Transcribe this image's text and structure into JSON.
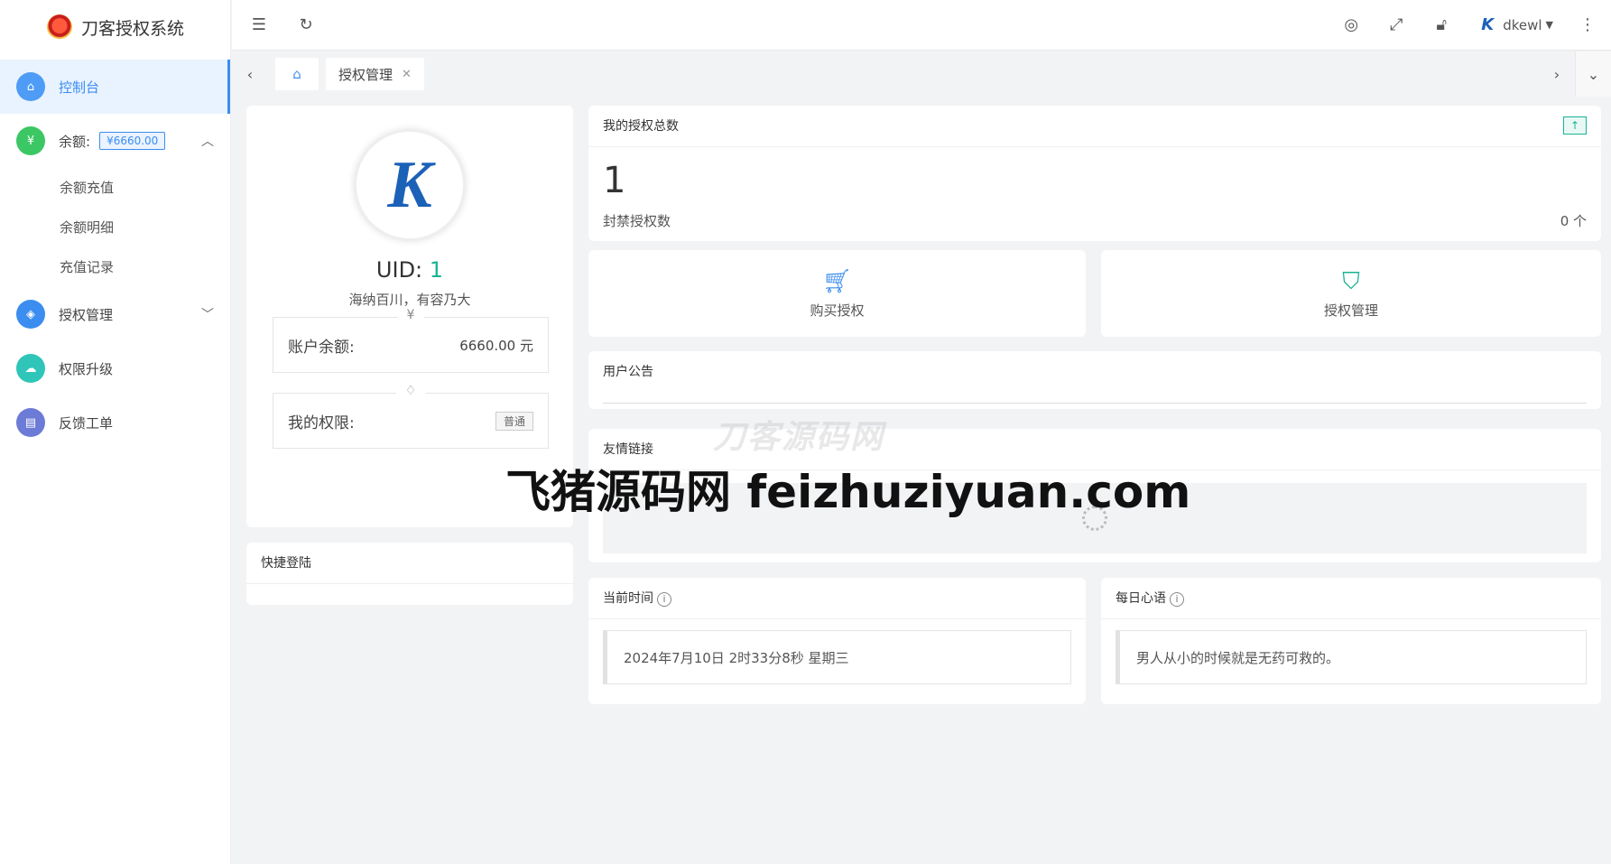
{
  "app": {
    "title": "刀客授权系统"
  },
  "sidebar": {
    "items": [
      {
        "label": "控制台",
        "icon": "home-icon",
        "color": "#4e9cf5"
      },
      {
        "label": "余额:",
        "icon": "yen-icon",
        "color": "#3bc763",
        "badge": "¥6660.00"
      },
      {
        "label": "授权管理",
        "icon": "shield-icon",
        "color": "#3b8df0"
      },
      {
        "label": "权限升级",
        "icon": "cloud-upload-icon",
        "color": "#2fc5b9"
      },
      {
        "label": "反馈工单",
        "icon": "document-icon",
        "color": "#6c7bd6"
      }
    ],
    "balance_submenu": [
      "余额充值",
      "余额明细",
      "充值记录"
    ]
  },
  "header": {
    "username": "dkewl"
  },
  "tabs": {
    "items": [
      {
        "label": "授权管理"
      }
    ]
  },
  "profile": {
    "uid_label": "UID:",
    "uid_value": "1",
    "motto": "海纳百川，有容乃大",
    "balance_label": "账户余额:",
    "balance_value": "6660.00 元",
    "permission_label": "我的权限:",
    "permission_value": "普通"
  },
  "quick_login": {
    "title": "快捷登陆"
  },
  "auth_total": {
    "title": "我的授权总数",
    "value": "1",
    "banned_label": "封禁授权数",
    "banned_value": "0 个"
  },
  "actions": {
    "buy_label": "购买授权",
    "manage_label": "授权管理"
  },
  "notice": {
    "title": "用户公告"
  },
  "links": {
    "title": "友情链接"
  },
  "time": {
    "title": "当前时间",
    "value": "2024年7月10日 2时33分8秒 星期三"
  },
  "daily": {
    "title": "每日心语",
    "value": "男人从小的时候就是无药可救的。"
  },
  "watermarks": {
    "faint": "刀客源码网",
    "main": "飞猪源码网 feizhuziyuan.com"
  }
}
